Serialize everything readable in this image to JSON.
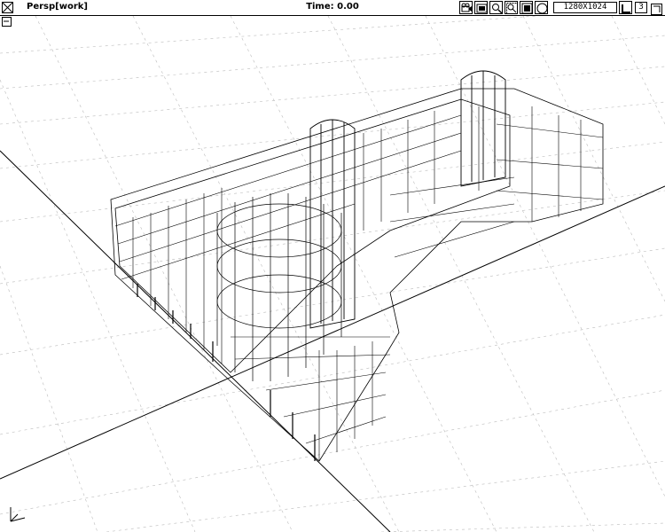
{
  "window": {
    "view_label": "Persp[work]",
    "time_label": "Time: 0.00",
    "resolution": "1280X1024",
    "layer_number": "3"
  },
  "toolbar": {
    "icons": [
      "camera-icon",
      "render-icon",
      "zoom-icon",
      "zoom-region-icon",
      "rotate-icon",
      "sphere-icon",
      "pan-icon"
    ]
  },
  "scene": {
    "type": "wireframe-building-perspective"
  }
}
